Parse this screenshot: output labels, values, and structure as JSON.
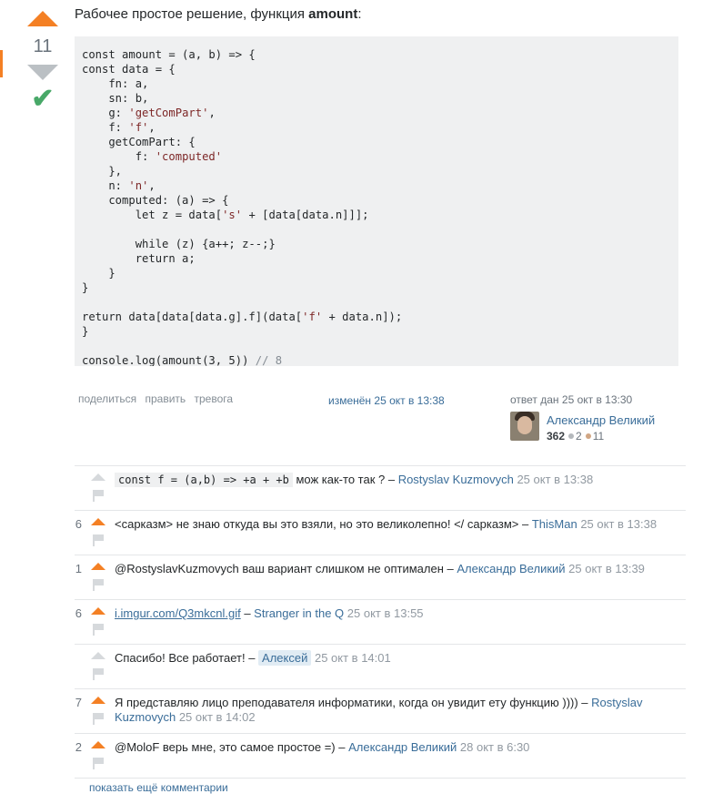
{
  "vote": {
    "count": "11"
  },
  "answer": {
    "intro_prefix": "Рабочее простое решение, функция ",
    "intro_bold": "amount",
    "intro_suffix": ":"
  },
  "menu": {
    "share": "поделиться",
    "edit": "править",
    "flag": "тревога"
  },
  "edited": "изменён 25 окт в 13:38",
  "signature": {
    "asked": "ответ дан 25 окт в 13:30",
    "name": "Александр Великий",
    "reputation": "362",
    "silver": "2",
    "bronze": "11"
  },
  "colors": {
    "accent": "#f48024",
    "accepted": "#48a868",
    "link": "#3a6d99"
  },
  "comments": [
    {
      "score": "",
      "code": "const f = (a,b) => +a + +b",
      "text": " мож как-то так ? – ",
      "user": "Rostyslav Kuzmovych",
      "date": " 25 окт в 13:38"
    },
    {
      "score": "6",
      "text": "<сарказм> не знаю откуда вы это взяли, но это великолепно! </ сарказм> – ",
      "user": "ThisMan",
      "date": " 25 окт в 13:38"
    },
    {
      "score": "1",
      "text": "@RostyslavKuzmovych ваш вариант слишком не оптимален – ",
      "user": "Александр Великий",
      "date": " 25 окт в 13:39"
    },
    {
      "score": "6",
      "link": "i.imgur.com/Q3mkcnl.gif",
      "text": " – ",
      "user": "Stranger in the Q",
      "date": " 25 окт в 13:55"
    },
    {
      "score": "",
      "text": "Спасибо! Все работает! – ",
      "user": "Алексей",
      "date": " 25 окт в 14:01"
    },
    {
      "score": "7",
      "text": "Я представляю лицо преподавателя информатики, когда он увидит ету функцию )))) – ",
      "user": "Rostyslav Kuzmovych",
      "date": " 25 окт в 14:02"
    },
    {
      "score": "2",
      "text": "@MoloF верь мне, это самое простое =) – ",
      "user": "Александр Великий",
      "date": " 28 окт в 6:30"
    }
  ],
  "more_comments": "показать ещё комментарии"
}
